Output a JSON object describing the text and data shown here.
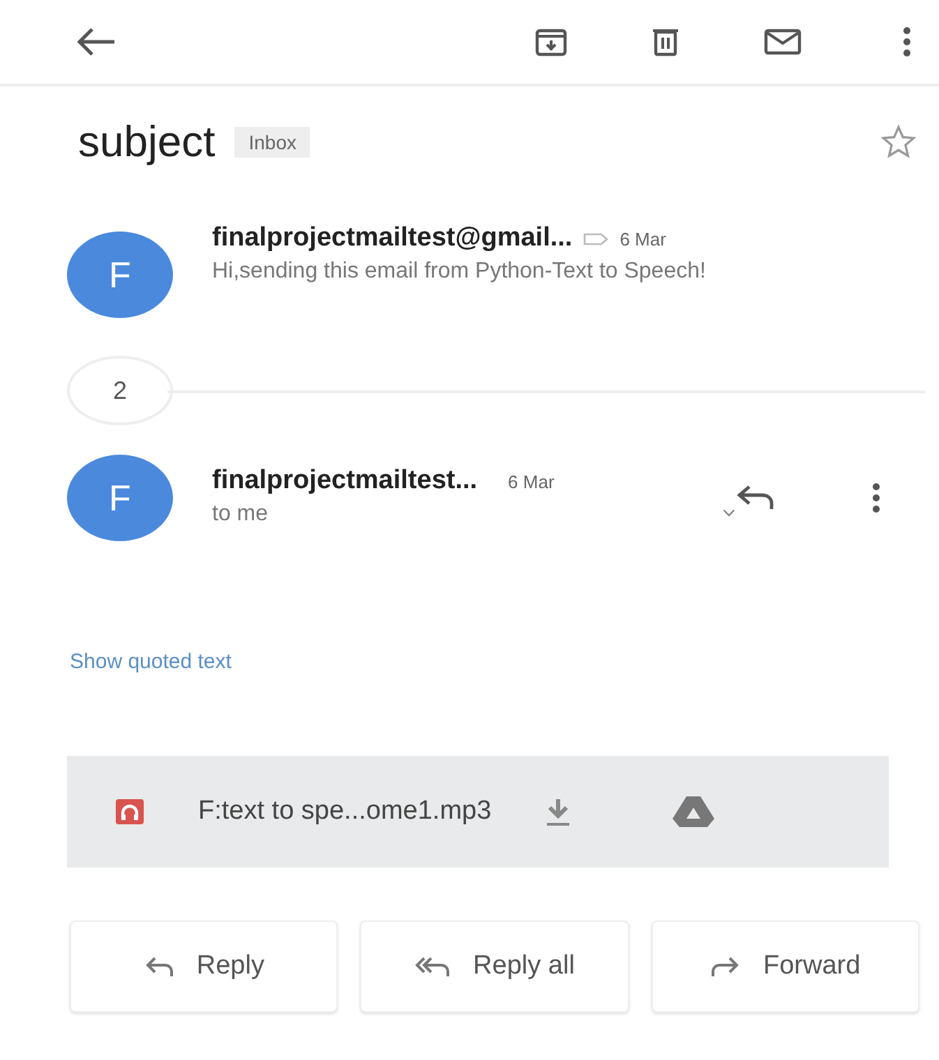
{
  "subject": {
    "title": "subject",
    "label": "Inbox",
    "starred": false
  },
  "messages": [
    {
      "kind": "expanded_snippet",
      "initial": "F",
      "sender": "finalprojectmailtest@gmail...",
      "date": "6 Mar",
      "snippet": "Hi,sending this email from Python-Text to Speech!"
    },
    {
      "kind": "collapsed_count",
      "count": "2"
    },
    {
      "kind": "open",
      "initial": "F",
      "sender": "finalprojectmailtest...",
      "date": "6 Mar",
      "recipient": "to me"
    }
  ],
  "quoted_link": "Show quoted text",
  "attachment": {
    "name": "F:text to spe...ome1.mp3"
  },
  "actions": [
    {
      "kind": "reply",
      "label": "Reply"
    },
    {
      "kind": "reply_all",
      "label": "Reply all"
    },
    {
      "kind": "forward",
      "label": "Forward"
    }
  ]
}
